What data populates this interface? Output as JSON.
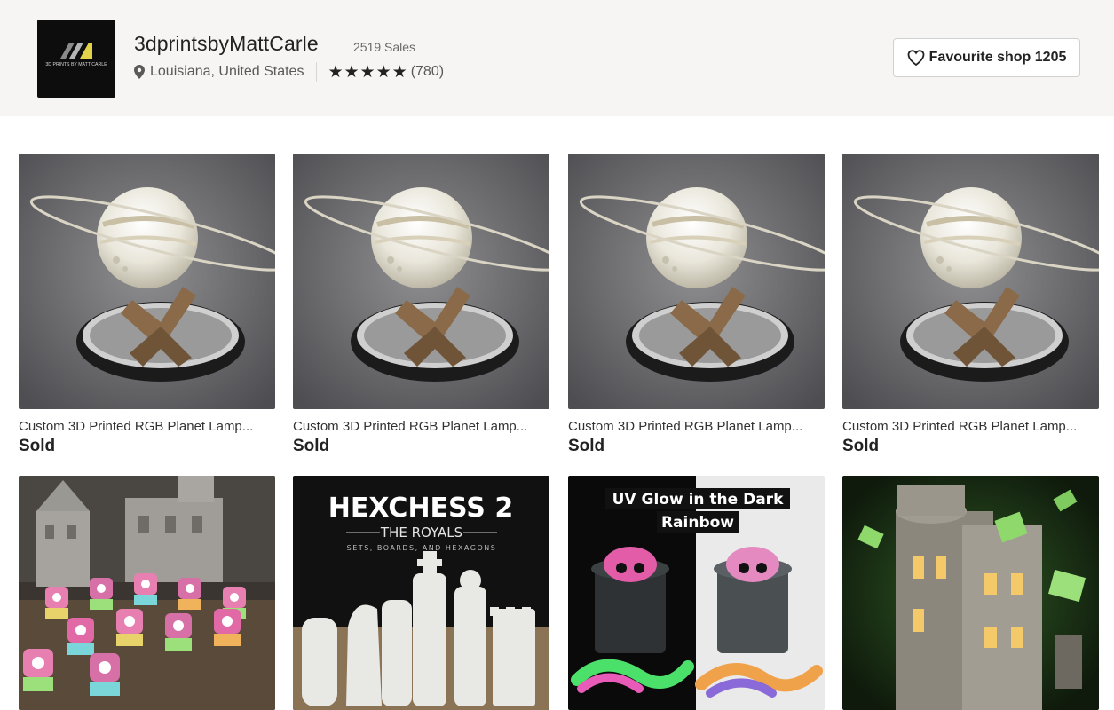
{
  "shop": {
    "name": "3dprintsbyMattCarle",
    "sales": "2519 Sales",
    "location": "Louisiana, United States",
    "rating_stars": 5,
    "review_count": "(780)",
    "logo_text": "3D PRINTS BY MATT CARLE"
  },
  "favourite": {
    "label": "Favourite shop 1205"
  },
  "listings": [
    {
      "title": "Custom 3D Printed RGB Planet Lamp...",
      "status": "Sold"
    },
    {
      "title": "Custom 3D Printed RGB Planet Lamp...",
      "status": "Sold"
    },
    {
      "title": "Custom 3D Printed RGB Planet Lamp...",
      "status": "Sold"
    },
    {
      "title": "Custom 3D Printed RGB Planet Lamp...",
      "status": "Sold"
    },
    {
      "title": "",
      "status": ""
    },
    {
      "title": "",
      "status": ""
    },
    {
      "title": "",
      "status": ""
    },
    {
      "title": "",
      "status": ""
    }
  ],
  "image_text": {
    "hexchess_title": "HEXCHESS 2",
    "hexchess_sub": "THE ROYALS",
    "hexchess_tagline": "SETS, BOARDS, AND HEXAGONS",
    "uv_line1": "UV Glow in the Dark",
    "uv_line2": "Rainbow"
  },
  "icons": {
    "location": "map-pin-icon",
    "star": "star-icon",
    "favourite": "heart-icon"
  }
}
